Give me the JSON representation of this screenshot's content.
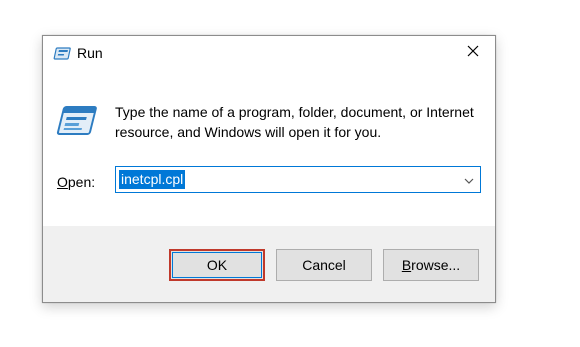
{
  "window": {
    "title": "Run",
    "icon": "run-icon",
    "close_icon": "close-icon"
  },
  "content": {
    "description": "Type the name of a program, folder, document, or Internet resource, and Windows will open it for you.",
    "open_label_underlined": "O",
    "open_label_rest": "pen:",
    "open_value": "inetcpl.cpl",
    "dropdown_icon": "chevron-down-icon"
  },
  "buttons": {
    "ok": "OK",
    "cancel": "Cancel",
    "browse_underlined": "B",
    "browse_rest": "rowse..."
  },
  "colors": {
    "accent": "#0078d7",
    "highlight_border": "#c0392b",
    "footer_bg": "#f0f0f0"
  }
}
